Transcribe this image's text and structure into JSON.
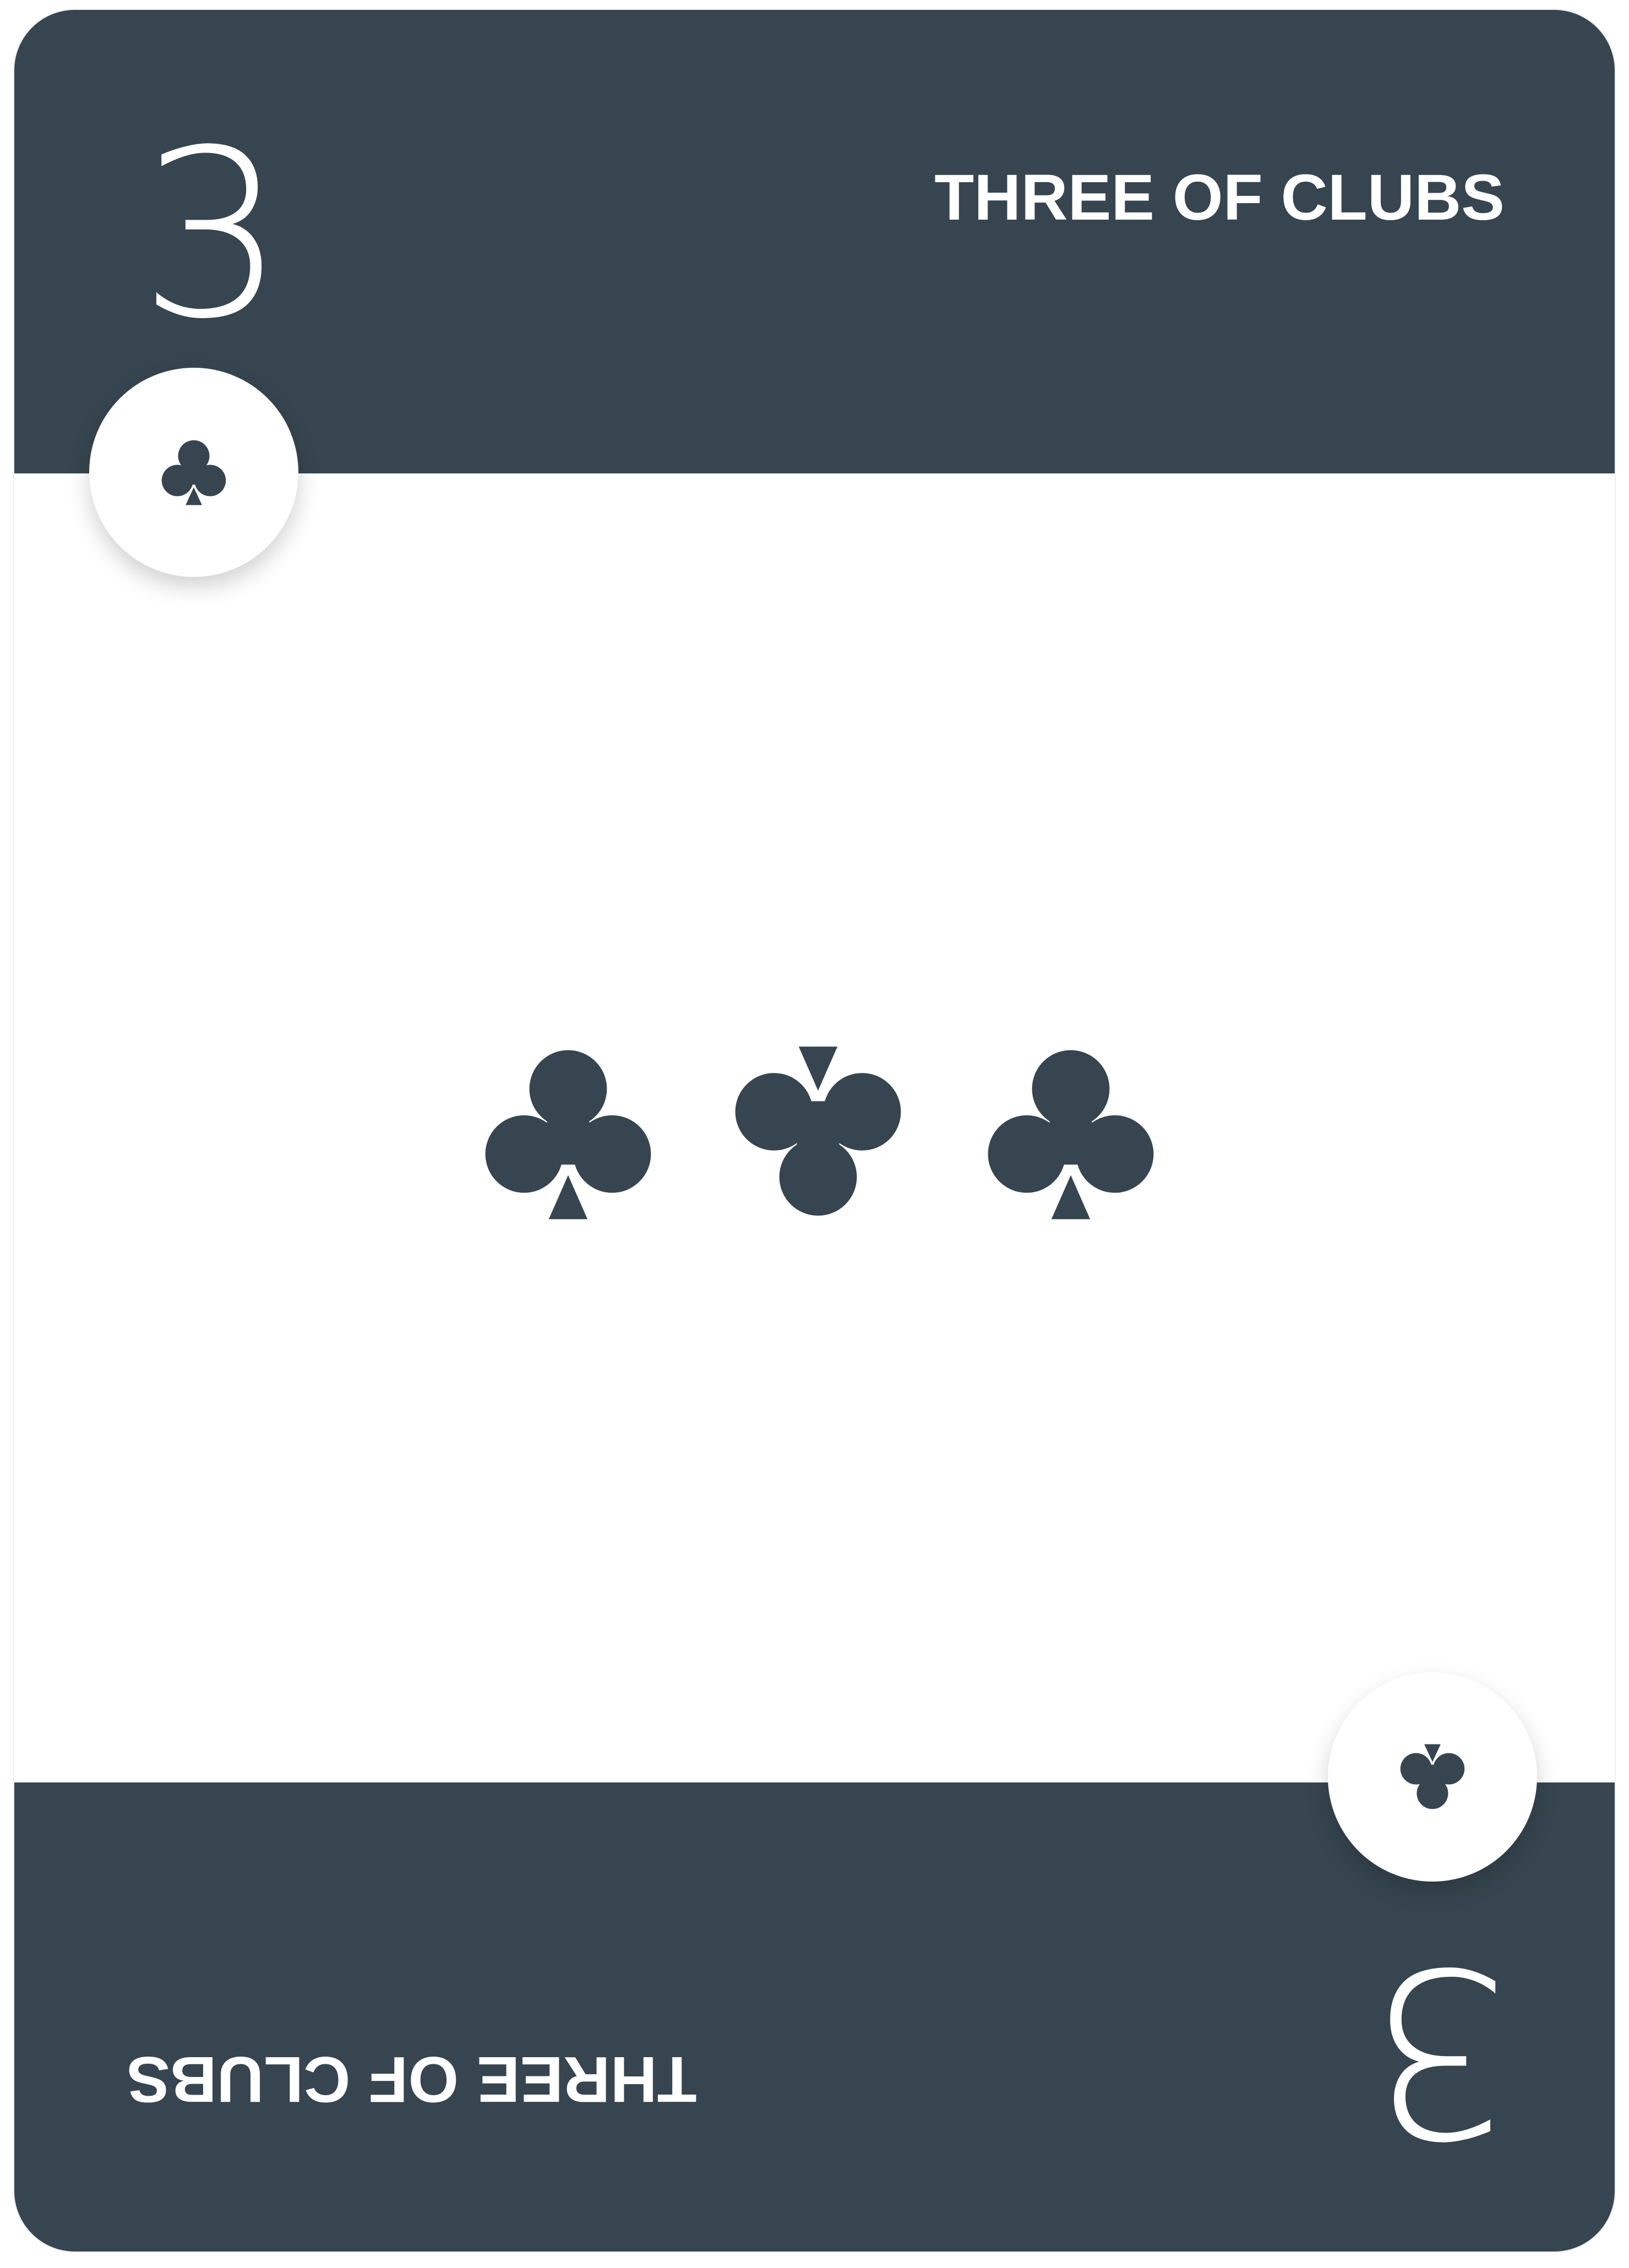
{
  "card": {
    "rank": "3",
    "title": "THREE OF CLUBS",
    "suit_icon": "club-icon",
    "pip_count": 3,
    "colors": {
      "band": "#36454f",
      "face": "#ffffff",
      "suit": "#36454f",
      "text_on_band": "#ffffff"
    }
  }
}
